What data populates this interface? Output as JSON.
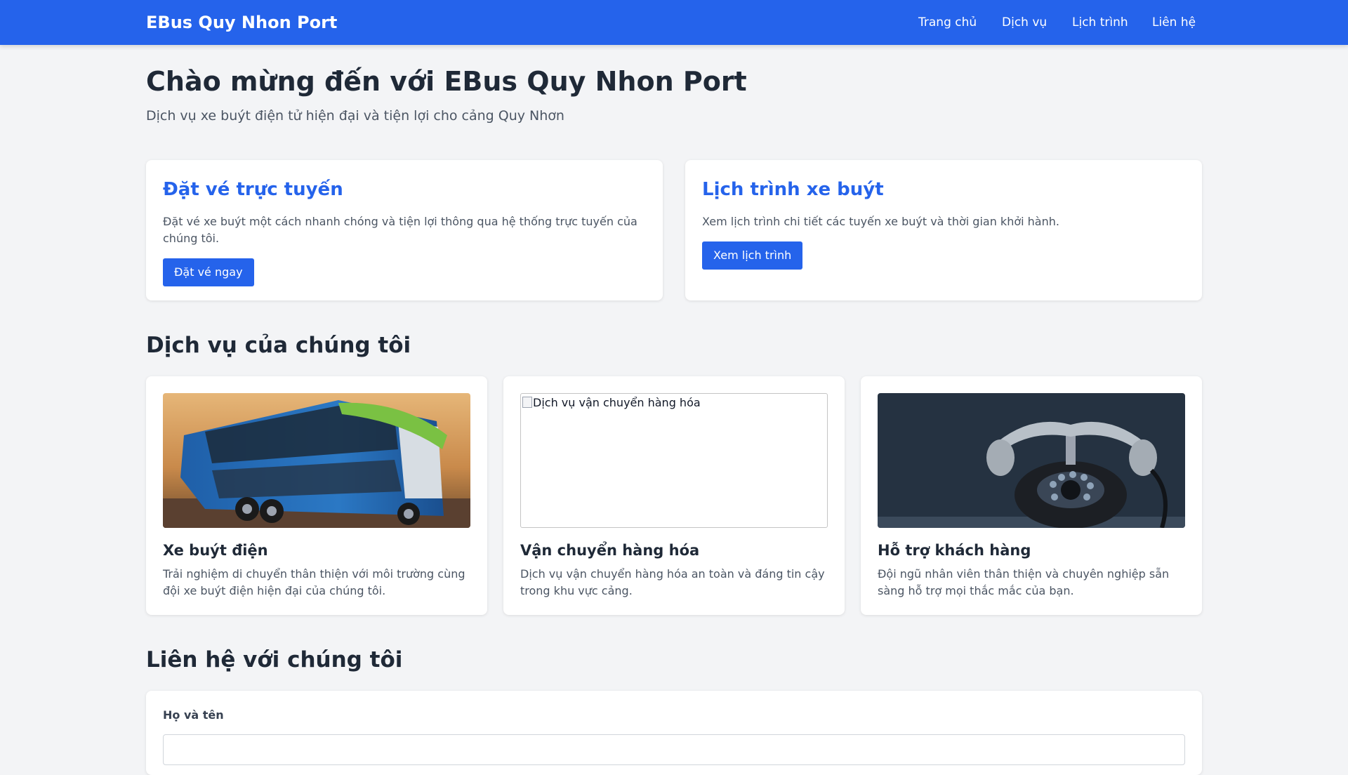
{
  "navbar": {
    "brand": "EBus Quy Nhon Port",
    "links": [
      {
        "label": "Trang chủ"
      },
      {
        "label": "Dịch vụ"
      },
      {
        "label": "Lịch trình"
      },
      {
        "label": "Liên hệ"
      }
    ],
    "color": "#2563eb"
  },
  "hero": {
    "title": "Chào mừng đến với EBus Quy Nhon Port",
    "subtitle": "Dịch vụ xe buýt điện tử hiện đại và tiện lợi cho cảng Quy Nhơn"
  },
  "actions": [
    {
      "title": "Đặt vé trực tuyến",
      "description": "Đặt vé xe buýt một cách nhanh chóng và tiện lợi thông qua hệ thống trực tuyến của chúng tôi.",
      "button": "Đặt vé ngay"
    },
    {
      "title": "Lịch trình xe buýt",
      "description": "Xem lịch trình chi tiết các tuyến xe buýt và thời gian khởi hành.",
      "button": "Xem lịch trình"
    }
  ],
  "services": {
    "heading": "Dịch vụ của chúng tôi",
    "items": [
      {
        "image": "bus-photo",
        "title": "Xe buýt điện",
        "description": "Trải nghiệm di chuyển thân thiện với môi trường cùng đội xe buýt điện hiện đại của chúng tôi."
      },
      {
        "image_alt": "Dịch vụ vận chuyển hàng hóa",
        "title": "Vận chuyển hàng hóa",
        "description": "Dịch vụ vận chuyển hàng hóa an toàn và đáng tin cậy trong khu vực cảng."
      },
      {
        "image": "telephone-photo",
        "title": "Hỗ trợ khách hàng",
        "description": "Đội ngũ nhân viên thân thiện và chuyên nghiệp sẵn sàng hỗ trợ mọi thắc mắc của bạn."
      }
    ]
  },
  "contact": {
    "heading": "Liên hệ với chúng tôi",
    "name_label": "Họ và tên",
    "name_value": ""
  }
}
